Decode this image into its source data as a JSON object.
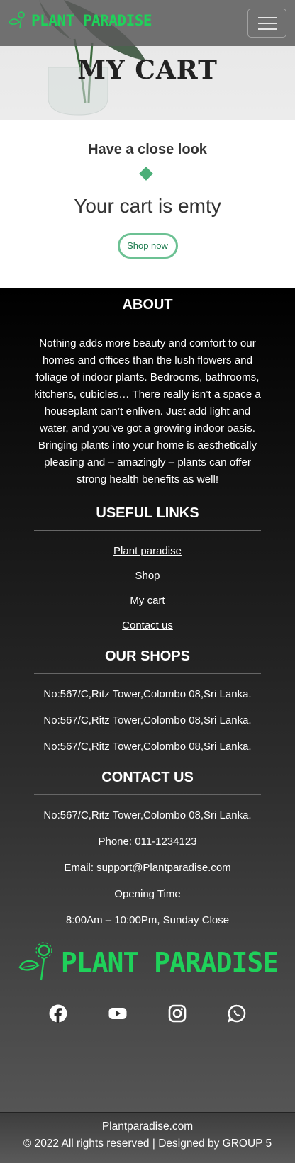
{
  "navbar": {
    "brand": "PLANT PARADISE",
    "menu_icon": "hamburger-icon"
  },
  "hero": {
    "title": "MY CART"
  },
  "cart": {
    "subtitle": "Have a close look",
    "empty_message": "Your cart is emty",
    "shop_button": "Shop now"
  },
  "footer": {
    "about": {
      "heading": "ABOUT",
      "text": "Nothing adds more beauty and comfort to our homes and offices than the lush flowers and foliage of indoor plants. Bedrooms, bathrooms, kitchens, cubicles… There really isn’t a space a houseplant can’t enliven. Just add light and water, and you’ve got a growing indoor oasis. Bringing plants into your home is aesthetically pleasing and – amazingly – plants can offer strong health benefits as well!"
    },
    "useful_links": {
      "heading": "USEFUL LINKS",
      "items": [
        "Plant paradise",
        "Shop",
        "My cart",
        "Contact us"
      ]
    },
    "our_shops": {
      "heading": "OUR SHOPS",
      "items": [
        "No:567/C,Ritz Tower,Colombo 08,Sri Lanka.",
        "No:567/C,Ritz Tower,Colombo 08,Sri Lanka.",
        "No:567/C,Ritz Tower,Colombo 08,Sri Lanka."
      ]
    },
    "contact": {
      "heading": "CONTACT US",
      "address": "No:567/C,Ritz Tower,Colombo 08,Sri Lanka.",
      "phone": "Phone: 011-1234123",
      "email": "Email: support@Plantparadise.com",
      "opening_label": "Opening Time",
      "opening_hours": "8:00Am – 10:00Pm, Sunday Close"
    },
    "logo_text": "PLANT PARADISE",
    "socials": [
      "facebook-icon",
      "youtube-icon",
      "instagram-icon",
      "whatsapp-icon"
    ]
  },
  "bottom": {
    "site": "Plantparadise.com",
    "copyright": "© 2022 All rights reserved | Designed by GROUP 5"
  },
  "colors": {
    "brand_green": "#1fd15a",
    "accent_green": "#4caf78",
    "button_text": "#1a7a4c"
  }
}
